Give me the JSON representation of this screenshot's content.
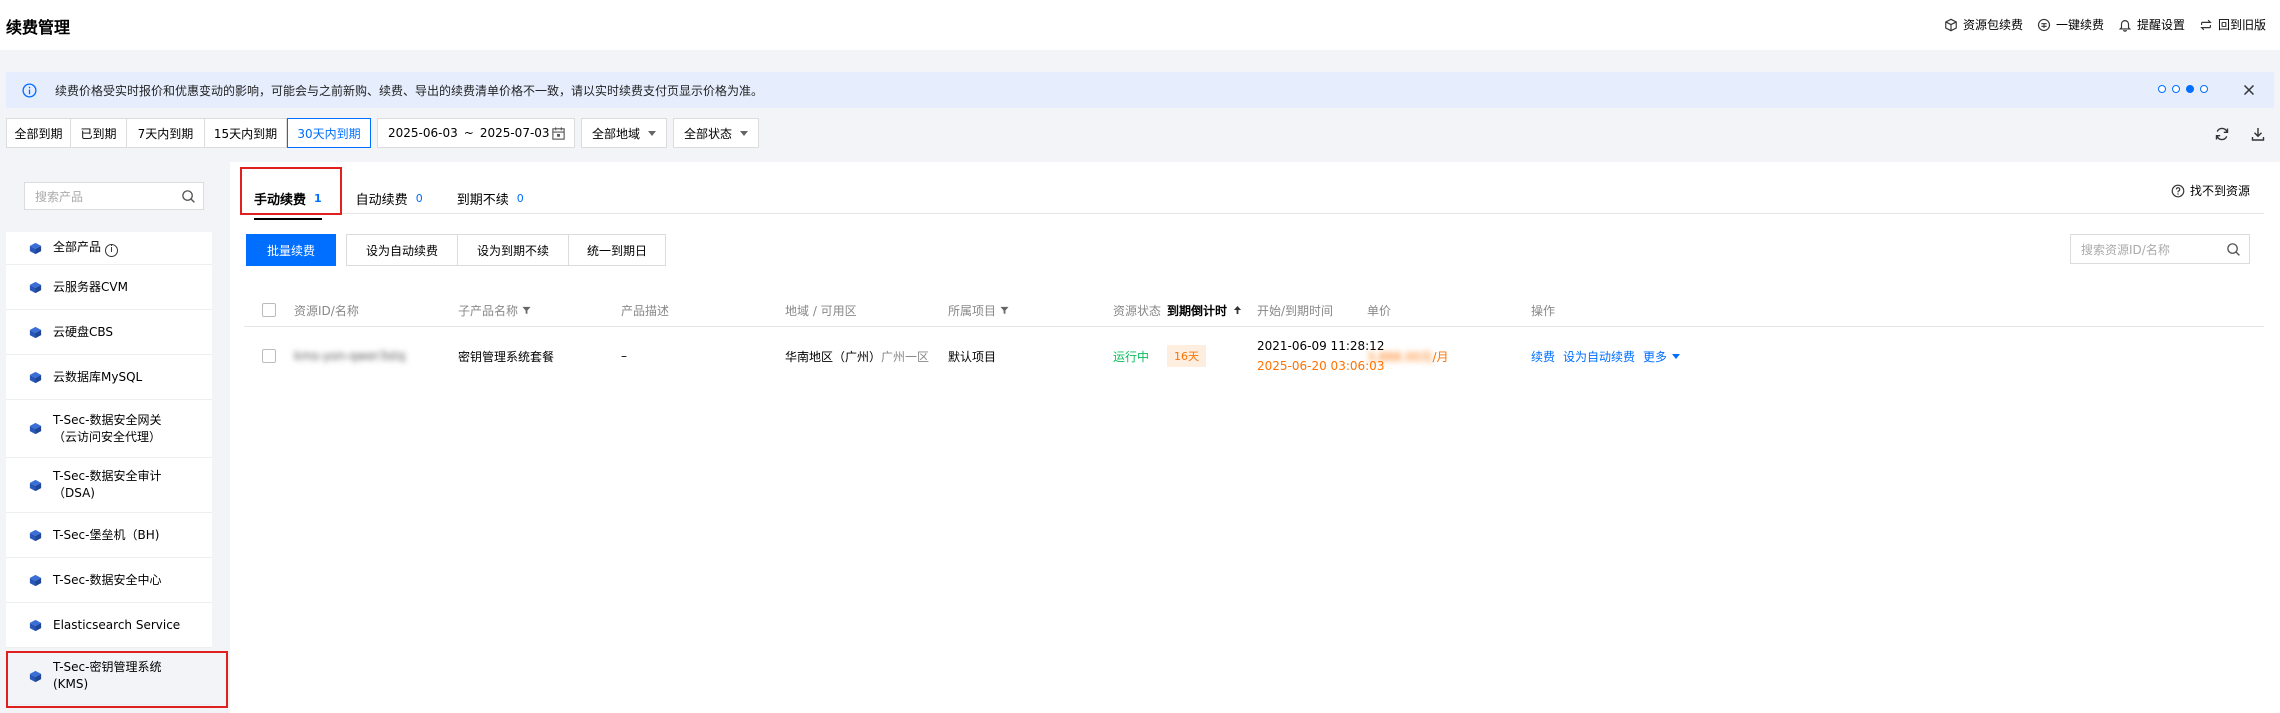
{
  "header": {
    "title": "续费管理",
    "actions": [
      {
        "label": "资源包续费",
        "icon": "package-icon"
      },
      {
        "label": "一键续费",
        "icon": "one-click-icon"
      },
      {
        "label": "提醒设置",
        "icon": "bell-icon"
      },
      {
        "label": "回到旧版",
        "icon": "swap-icon"
      }
    ]
  },
  "notice": {
    "text": "续费价格受实时报价和优惠变动的影响，可能会与之前新购、续费、导出的续费清单价格不一致，请以实时续费支付页显示价格为准。",
    "page_count": 4,
    "active_index": 2
  },
  "filters": {
    "expiry_options": [
      "全部到期",
      "已到期",
      "7天内到期",
      "15天内到期",
      "30天内到期"
    ],
    "active_expiry": "30天内到期",
    "date_start": "2025-06-03",
    "date_sep": "~",
    "date_end": "2025-07-03",
    "region": "全部地域",
    "status": "全部状态"
  },
  "sidebar": {
    "search_placeholder": "搜索产品",
    "items": [
      {
        "label": "全部产品",
        "info": "i"
      },
      {
        "label": "云服务器CVM"
      },
      {
        "label": "云硬盘CBS"
      },
      {
        "label": "云数据库MySQL"
      },
      {
        "label": "T-Sec-数据安全网关\n（云访问安全代理）"
      },
      {
        "label": "T-Sec-数据安全审计\n（DSA)"
      },
      {
        "label": "T-Sec-堡垒机（BH)"
      },
      {
        "label": "T-Sec-数据安全中心"
      },
      {
        "label": "Elasticsearch Service"
      },
      {
        "label": "T-Sec-密钥管理系统\n(KMS)"
      }
    ],
    "selected": "T-Sec-密钥管理系统\n(KMS)"
  },
  "tabs": [
    {
      "label": "手动续费",
      "count": "1"
    },
    {
      "label": "自动续费",
      "count": "0"
    },
    {
      "label": "到期不续",
      "count": "0"
    }
  ],
  "cant_find": "找不到资源",
  "batch_actions": {
    "primary": "批量续费",
    "set_auto": "设为自动续费",
    "set_no_renew": "设为到期不续",
    "unify_date": "统一到期日"
  },
  "resource_search_placeholder": "搜索资源ID/名称",
  "table": {
    "columns": {
      "resource": "资源ID/名称",
      "sub_product": "子产品名称",
      "description": "产品描述",
      "region": "地域 / 可用区",
      "project": "所属项目",
      "status": "资源状态",
      "countdown": "到期倒计时",
      "time": "开始/到期时间",
      "price": "单价",
      "ops": "操作"
    },
    "rows": [
      {
        "resource": "kms-yon-qwer3stq",
        "sub_product": "密钥管理系统套餐",
        "description": "–",
        "region": "华南地区（广州）",
        "zone": "广州一区",
        "project": "默认项目",
        "status": "运行中",
        "countdown": "16天",
        "start_time": "2021-06-09 11:28:12",
        "end_time": "2025-06-20 03:06:03",
        "price": "3,888.00元",
        "price_unit": "/月",
        "op_renew": "续费",
        "op_auto": "设为自动续费",
        "op_more": "更多"
      }
    ]
  },
  "colors": {
    "primary": "#006eff",
    "warning": "#ff7200",
    "success": "#0abf5b",
    "highlight": "#e0201e"
  }
}
